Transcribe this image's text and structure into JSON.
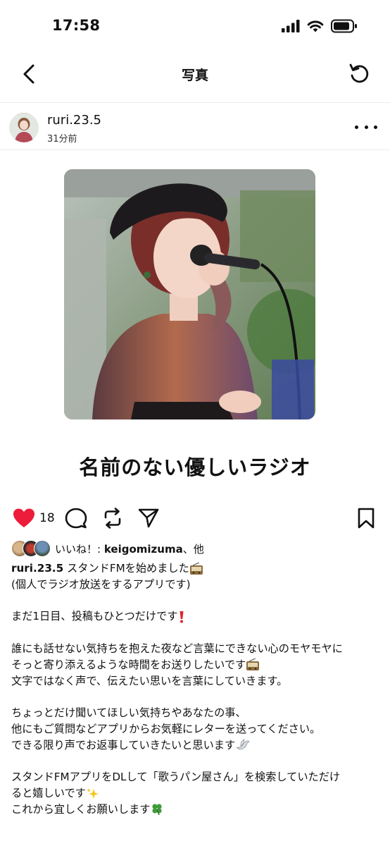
{
  "status_bar": {
    "time": "17:58"
  },
  "nav": {
    "title": "写真"
  },
  "post": {
    "username": "ruri.23.5",
    "time_ago": "31分前",
    "photo_title": "名前のない優しいラジオ",
    "like_count": "18",
    "liked_by_prefix": "いいね！: ",
    "liked_by_user": "keigomizuma",
    "liked_by_suffix": "、他",
    "caption_user": "ruri.23.5",
    "caption_lines": [
      "スタンドFMを始めました",
      "(個人でラジオ放送をするアプリです)",
      "",
      "まだ1日目、投稿もひとつだけです",
      "",
      "誰にも話せない気持ちを抱えた夜など言葉にできない心のモヤモヤに",
      "そっと寄り添えるような時間をお送りしたいです",
      "文字ではなく声で、伝えたい思いを言葉にしていきます。",
      "",
      "ちょっとだけ聞いてほしい気持ちやあなたの事、",
      "他にもご質問などアプリからお気軽にレターを送ってください。",
      "できる限り声でお返事していきたいと思います",
      "",
      "スタンドFMアプリをDLして「歌うパン屋さん」を検索していただけ",
      "ると嬉しいです",
      "これから宜しくお願いします"
    ]
  },
  "icons": {
    "heart": "heart-filled-icon",
    "comment": "comment-icon",
    "repost": "repost-icon",
    "share": "send-icon",
    "bookmark": "bookmark-icon"
  },
  "colors": {
    "like": "#ed1c3a",
    "text": "#111111"
  }
}
